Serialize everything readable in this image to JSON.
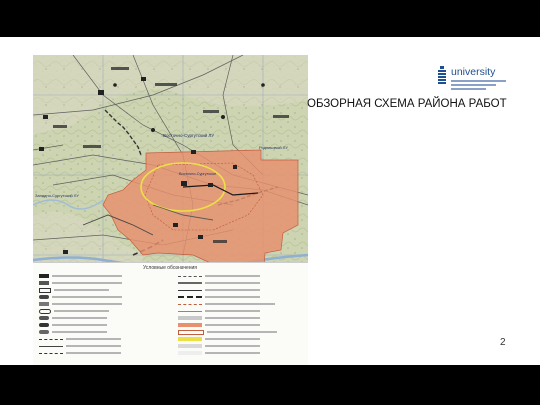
{
  "slide": {
    "title": "ОБЗОРНАЯ СХЕМА РАЙОНА РАБОТ",
    "page_number": "2"
  },
  "logo": {
    "wordmark": "university",
    "brand_color": "#1d4f91"
  },
  "map": {
    "labels": {
      "vostochno_surgutskiy_lu": "Восточно-Сургутский ЛУ",
      "vostochno_surgutskoe": "Восточно-Сургутское",
      "rodnikovyi_lu": "Родниковый ЛУ",
      "zapadno_surgutskiy_lu": "Западно-Сургутский ЛУ",
      "yuzhno_surgutskiy": "Южно-Сургутский"
    },
    "legend": {
      "title": "Условные обозначения"
    },
    "colors": {
      "license_area": "#e9906f",
      "highlight_ellipse": "#e8dd42",
      "terrain": "#c9d2ae"
    }
  }
}
